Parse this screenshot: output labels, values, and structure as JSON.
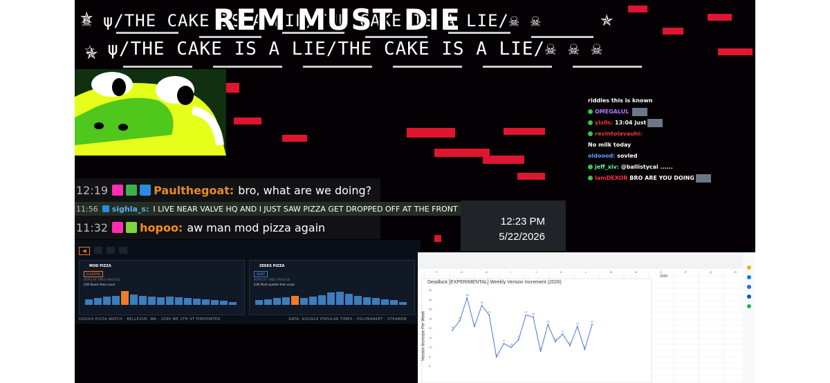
{
  "banner": {
    "big_title": "REM MUST DIE",
    "line1": "☠ ψ/THE CAKE IS A LIE/THE CAKE IS A LIE/☠ ☠",
    "line2": "☆ ψ/THE CAKE IS A LIE/THE CAKE IS A LIE/☠ ☠ ☠"
  },
  "overlay_chat": {
    "messages": [
      {
        "user": "",
        "text": "riddles this is known"
      },
      {
        "user": "OMEGALUL",
        "text": ""
      },
      {
        "user": "yis0s:",
        "text": "13:04 just"
      },
      {
        "user": "revintolavauhi:",
        "text": ""
      },
      {
        "user": "",
        "text": "No milk today"
      },
      {
        "user": "oldoood:",
        "text": "sovled"
      },
      {
        "user": "jeff_xiv:",
        "text": "@ballistycal ......"
      },
      {
        "user": "lamDEXOR",
        "text": "BRO ARE YOU DOING"
      }
    ]
  },
  "main_chat": {
    "messages": [
      {
        "time": "12:19",
        "user": "Paulthegoat:",
        "text": "bro, what are we doing?",
        "user_color": "#e48a2a"
      },
      {
        "time": "11:56",
        "user": "sighla_s:",
        "text": "I LIVE NEAR VALVE HQ AND I JUST SAW PIZZA GET DROPPED OFF AT THE FRONT",
        "user_color": "#5ab0f0"
      },
      {
        "time": "11:32",
        "user": "hopoo:",
        "text": "aw man mod pizza again",
        "user_color": "#ff8c1a"
      }
    ]
  },
  "clock": {
    "time": "12:23 PM",
    "date": "5/22/2026"
  },
  "dashboard": {
    "cards": [
      {
        "title": "MOD PIZZA",
        "status": "ELEVATED",
        "subtitle": "POPULAR TIMES ANALYSIS",
        "live": "LIVE Busier than usual",
        "bars": [
          0.35,
          0.45,
          0.55,
          0.6,
          0.9,
          0.7,
          0.6,
          0.55,
          0.5,
          0.55,
          0.5,
          0.45,
          0.4,
          0.35,
          0.3,
          0.28,
          0.2
        ],
        "active": 4
      },
      {
        "title": "ZEEKS PIZZA",
        "status": "QUIET",
        "subtitle": "POPULAR TIMES ANALYSIS",
        "live": "LIVE Much quieter than usual",
        "bars": [
          0.3,
          0.35,
          0.45,
          0.5,
          0.6,
          0.45,
          0.55,
          0.65,
          0.8,
          0.85,
          0.75,
          0.6,
          0.5,
          0.45,
          0.35,
          0.3,
          0.2
        ],
        "active": 4
      }
    ],
    "footer_left": "DOUGH PIZZA WATCH · BELLEVUE, WA · 1090 WE 2TH ST PINPOINTED",
    "footer_right": "DATA: GOOGLE POPULAR TIMES · POLYMARKET · STEAMDB"
  },
  "sheet": {
    "chart_title": "Deadlock [EXPERIMENTAL] Weekly Version Increment (2026)",
    "ylabel": "Version Increase Per Week",
    "year_label": "2026",
    "columns": [
      "F",
      "G",
      "H",
      "I",
      "J",
      "K",
      "L",
      "M",
      "N",
      "O",
      "P",
      "Q",
      "R"
    ],
    "chart_data": {
      "type": "line",
      "title": "Deadlock [EXPERIMENTAL] Weekly Version Increment (2026)",
      "ylabel": "Version Increase Per Week",
      "x": [
        1,
        2,
        3,
        4,
        5,
        6,
        7,
        8,
        9,
        10,
        11,
        12,
        13,
        14,
        15,
        16,
        17,
        18,
        19,
        20
      ],
      "values": [
        19,
        24,
        36,
        21,
        32,
        27,
        5,
        12,
        10,
        14,
        27,
        26,
        8,
        22,
        13,
        17,
        11,
        21,
        9,
        22
      ]
    }
  },
  "colors": {
    "accent_red": "#e01530",
    "chat_green": "#36c452"
  }
}
